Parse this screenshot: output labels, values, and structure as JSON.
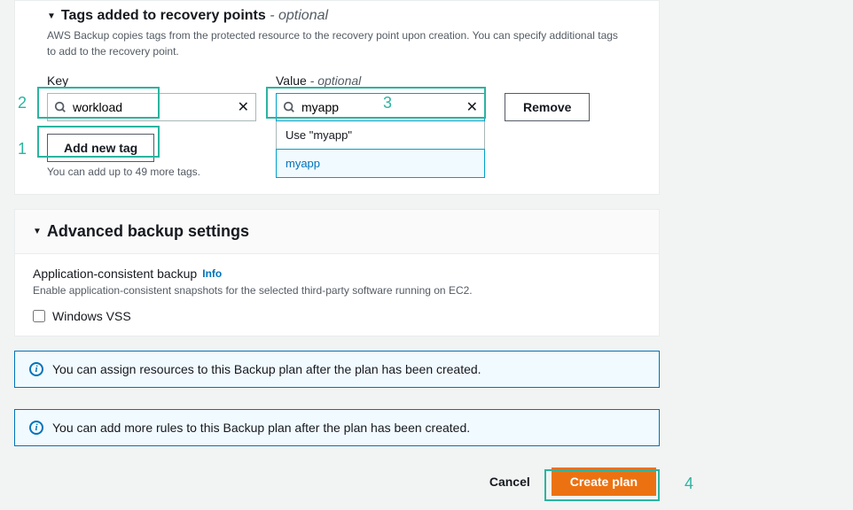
{
  "tags_section": {
    "title": "Tags added to recovery points",
    "optional_suffix": "- optional",
    "description": "AWS Backup copies tags from the protected resource to the recovery point upon creation. You can specify additional tags to add to the recovery point.",
    "key_label": "Key",
    "value_label": "Value",
    "value_optional_suffix": "- optional",
    "key_value": "workload",
    "value_value": "myapp",
    "remove_label": "Remove",
    "add_label": "Add new tag",
    "limit_note": "You can add up to 49 more tags.",
    "dropdown": {
      "use_text": "Use \"myapp\"",
      "option": "myapp"
    }
  },
  "advanced_section": {
    "title": "Advanced backup settings",
    "app_backup_title": "Application-consistent backup",
    "info_label": "Info",
    "app_backup_desc": "Enable application-consistent snapshots for the selected third-party software running on EC2.",
    "windows_vss_label": "Windows VSS"
  },
  "info_boxes": {
    "resources": "You can assign resources to this Backup plan after the plan has been created.",
    "rules": "You can add more rules to this Backup plan after the plan has been created."
  },
  "footer": {
    "cancel": "Cancel",
    "create": "Create plan"
  },
  "annotations": {
    "n1": "1",
    "n2": "2",
    "n3": "3",
    "n4": "4"
  }
}
